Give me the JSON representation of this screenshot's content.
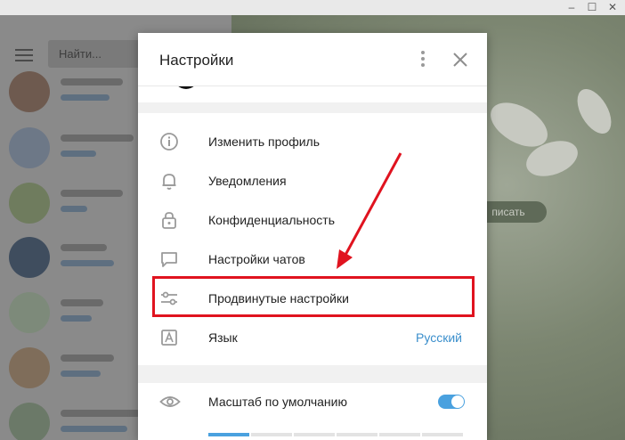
{
  "window": {
    "minimize_glyph": "–",
    "maximize_glyph": "☐",
    "close_glyph": "✕"
  },
  "sidebar": {
    "search_placeholder": "Найти..."
  },
  "chat": {
    "write_button": "писать"
  },
  "settings": {
    "title": "Настройки",
    "items": [
      {
        "label": "Изменить профиль",
        "icon": "info-icon"
      },
      {
        "label": "Уведомления",
        "icon": "bell-icon"
      },
      {
        "label": "Конфиденциальность",
        "icon": "lock-icon"
      },
      {
        "label": "Настройки чатов",
        "icon": "chat-bubble-icon"
      },
      {
        "label": "Продвинутые настройки",
        "icon": "sliders-icon"
      },
      {
        "label": "Язык",
        "icon": "language-icon",
        "value": "Русский"
      }
    ],
    "scale": {
      "label": "Масштаб по умолчанию",
      "icon": "eye-icon",
      "enabled": true
    }
  },
  "colors": {
    "accent": "#4aa1df",
    "link": "#3b8fcc",
    "annotation_red": "#e0131f"
  }
}
